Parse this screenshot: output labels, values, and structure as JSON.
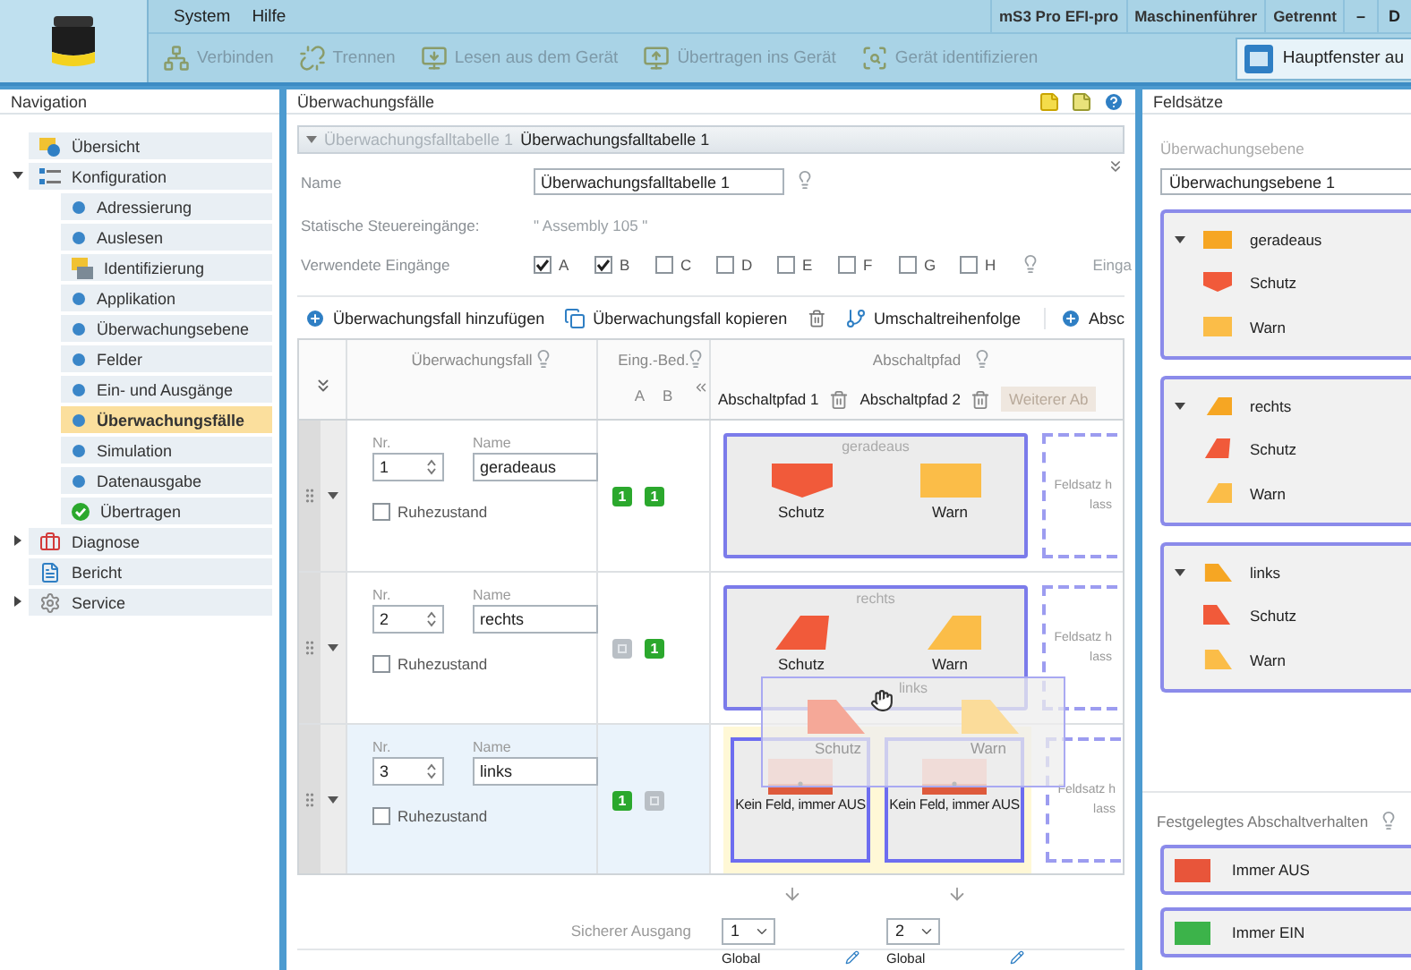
{
  "menu": [
    "System",
    "Hilfe"
  ],
  "status": [
    "mS3 Pro EFI-pro",
    "Maschinenführer",
    "Getrennt"
  ],
  "window_buttons": [
    "–",
    "D"
  ],
  "toolbar": [
    {
      "label": "Verbinden",
      "kind": "connect",
      "disabled": true
    },
    {
      "label": "Trennen",
      "kind": "disconnect",
      "disabled": true
    },
    {
      "label": "Lesen aus dem Gerät",
      "kind": "read",
      "disabled": true
    },
    {
      "label": "Übertragen ins Gerät",
      "kind": "write",
      "disabled": true
    },
    {
      "label": "Gerät identifizieren",
      "kind": "identify",
      "disabled": true
    }
  ],
  "main_window_button": "Hauptfenster au",
  "navigation": {
    "title": "Navigation",
    "items": [
      {
        "label": "Übersicht",
        "kind": "overview",
        "selected": false
      },
      {
        "label": "Konfiguration",
        "kind": "config",
        "expanded": true,
        "selected": false,
        "children": [
          {
            "label": "Adressierung",
            "kind": "step",
            "selected": false
          },
          {
            "label": "Auslesen",
            "kind": "step",
            "selected": false
          },
          {
            "label": "Identifizierung",
            "kind": "identify",
            "selected": false
          },
          {
            "label": "Applikation",
            "kind": "step",
            "selected": false
          },
          {
            "label": "Überwachungsebene",
            "kind": "step",
            "selected": false
          },
          {
            "label": "Felder",
            "kind": "step",
            "selected": false
          },
          {
            "label": "Ein- und Ausgänge",
            "kind": "step",
            "selected": false
          },
          {
            "label": "Überwachungsfälle",
            "kind": "step",
            "selected": true
          },
          {
            "label": "Simulation",
            "kind": "step",
            "selected": false
          },
          {
            "label": "Datenausgabe",
            "kind": "step",
            "selected": false
          },
          {
            "label": "Übertragen",
            "kind": "done",
            "selected": false
          }
        ]
      },
      {
        "label": "Diagnose",
        "kind": "diagnosis",
        "expanded": false,
        "selected": false
      },
      {
        "label": "Bericht",
        "kind": "report",
        "selected": false
      },
      {
        "label": "Service",
        "kind": "service",
        "expanded": false,
        "selected": false
      }
    ]
  },
  "cases": {
    "title": "Überwachungsfälle",
    "breadcrumb": [
      {
        "label": "Überwachungsfalltabelle 1",
        "selected": false
      },
      {
        "label": "Überwachungsfalltabelle 1",
        "selected": true
      }
    ],
    "name_label": "Name",
    "name_value": "Überwachungsfalltabelle 1",
    "static_label": "Statische Steuereingänge:",
    "static_value": "\" Assembly 105 \"",
    "inputs_label": "Verwendete Eingänge",
    "inputs": [
      {
        "label": "A",
        "checked": true
      },
      {
        "label": "B",
        "checked": true
      },
      {
        "label": "C",
        "checked": false
      },
      {
        "label": "D",
        "checked": false
      },
      {
        "label": "E",
        "checked": false
      },
      {
        "label": "F",
        "checked": false
      },
      {
        "label": "G",
        "checked": false
      },
      {
        "label": "H",
        "checked": false
      }
    ],
    "inputs_more": "Einga",
    "actions": {
      "add": "Überwachungsfall hinzufügen",
      "copy": "Überwachungsfall kopieren",
      "order": "Umschaltreihenfolge",
      "add_path": "Absc"
    },
    "table": {
      "case_header": "Überwachungsfall",
      "cond_header": "Eing.-Bed.",
      "cond_columns": [
        "A",
        "B"
      ],
      "path_header": "Abschaltpfad",
      "paths": [
        "Abschaltpfad 1",
        "Abschaltpfad 2"
      ],
      "more_paths": "Weiterer Ab",
      "rows": [
        {
          "nr_label": "Nr.",
          "name_label": "Name",
          "idle_label": "Ruhezustand",
          "nr": "1",
          "name": "geradeaus",
          "idle_state": false,
          "selected": false,
          "conditions": [
            {
              "kind": "one",
              "text": "1"
            },
            {
              "kind": "one",
              "text": "1"
            }
          ],
          "assignment": {
            "kind": "field_set",
            "title": "geradeaus",
            "fields": [
              {
                "label": "Schutz",
                "kind": "protect_straight",
                "color": "#f15a3a"
              },
              {
                "label": "Warn",
                "kind": "warn_straight",
                "color": "#fbbd48"
              }
            ]
          },
          "placeholder": [
            "Feldsatz h",
            "lass"
          ]
        },
        {
          "nr_label": "Nr.",
          "name_label": "Name",
          "idle_label": "Ruhezustand",
          "nr": "2",
          "name": "rechts",
          "idle_state": false,
          "selected": false,
          "conditions": [
            {
              "kind": "any"
            },
            {
              "kind": "one",
              "text": "1"
            }
          ],
          "assignment": {
            "kind": "field_set",
            "title": "rechts",
            "fields": [
              {
                "label": "Schutz",
                "kind": "protect_right",
                "color": "#f15a3a"
              },
              {
                "label": "Warn",
                "kind": "warn_right",
                "color": "#fbbd48"
              }
            ]
          },
          "placeholder": [
            "Feldsatz h",
            "lass"
          ]
        },
        {
          "nr_label": "Nr.",
          "name_label": "Name",
          "idle_label": "Ruhezustand",
          "nr": "3",
          "name": "links",
          "idle_state": false,
          "selected": true,
          "conditions": [
            {
              "kind": "one",
              "text": "1"
            },
            {
              "kind": "any"
            }
          ],
          "assignment": {
            "kind": "fixed",
            "highlighted": true,
            "cells": [
              {
                "label": "Kein Feld, immer AUS"
              },
              {
                "label": "Kein Feld, immer AUS"
              }
            ]
          },
          "placeholder": [
            "Feldsatz h",
            "lass"
          ]
        }
      ],
      "drag_preview": {
        "title": "links",
        "fields": [
          {
            "label": "Schutz",
            "kind": "protect_left",
            "color": "#f5a898"
          },
          {
            "label": "Warn",
            "kind": "warn_left",
            "color": "#fbdc9a"
          }
        ]
      },
      "output_label": "Sicherer Ausgang",
      "outputs": [
        {
          "value": "1",
          "mode": "Global"
        },
        {
          "value": "2",
          "mode": "Global"
        }
      ]
    }
  },
  "field_sets": {
    "title": "Feldsätze",
    "level_label": "Überwachungsebene",
    "level_value": "Überwachungsebene 1",
    "groups": [
      {
        "name": "geradeaus",
        "kind": "straight",
        "expanded": true,
        "fields": [
          {
            "label": "Schutz",
            "kind": "protect_straight",
            "color": "#f15a3a"
          },
          {
            "label": "Warn",
            "kind": "warn_straight",
            "color": "#fbbd48"
          }
        ]
      },
      {
        "name": "rechts",
        "kind": "right",
        "expanded": true,
        "fields": [
          {
            "label": "Schutz",
            "kind": "protect_right",
            "color": "#f15a3a"
          },
          {
            "label": "Warn",
            "kind": "warn_right",
            "color": "#fbbd48"
          }
        ]
      },
      {
        "name": "links",
        "kind": "left",
        "expanded": true,
        "fields": [
          {
            "label": "Schutz",
            "kind": "protect_left",
            "color": "#f15a3a"
          },
          {
            "label": "Warn",
            "kind": "warn_left",
            "color": "#fbbd48"
          }
        ]
      }
    ],
    "fixed_title": "Festgelegtes Abschaltverhalten",
    "fixed": [
      {
        "label": "Immer AUS",
        "color": "#e8553a"
      },
      {
        "label": "Immer EIN",
        "color": "#3cb34a"
      }
    ]
  }
}
